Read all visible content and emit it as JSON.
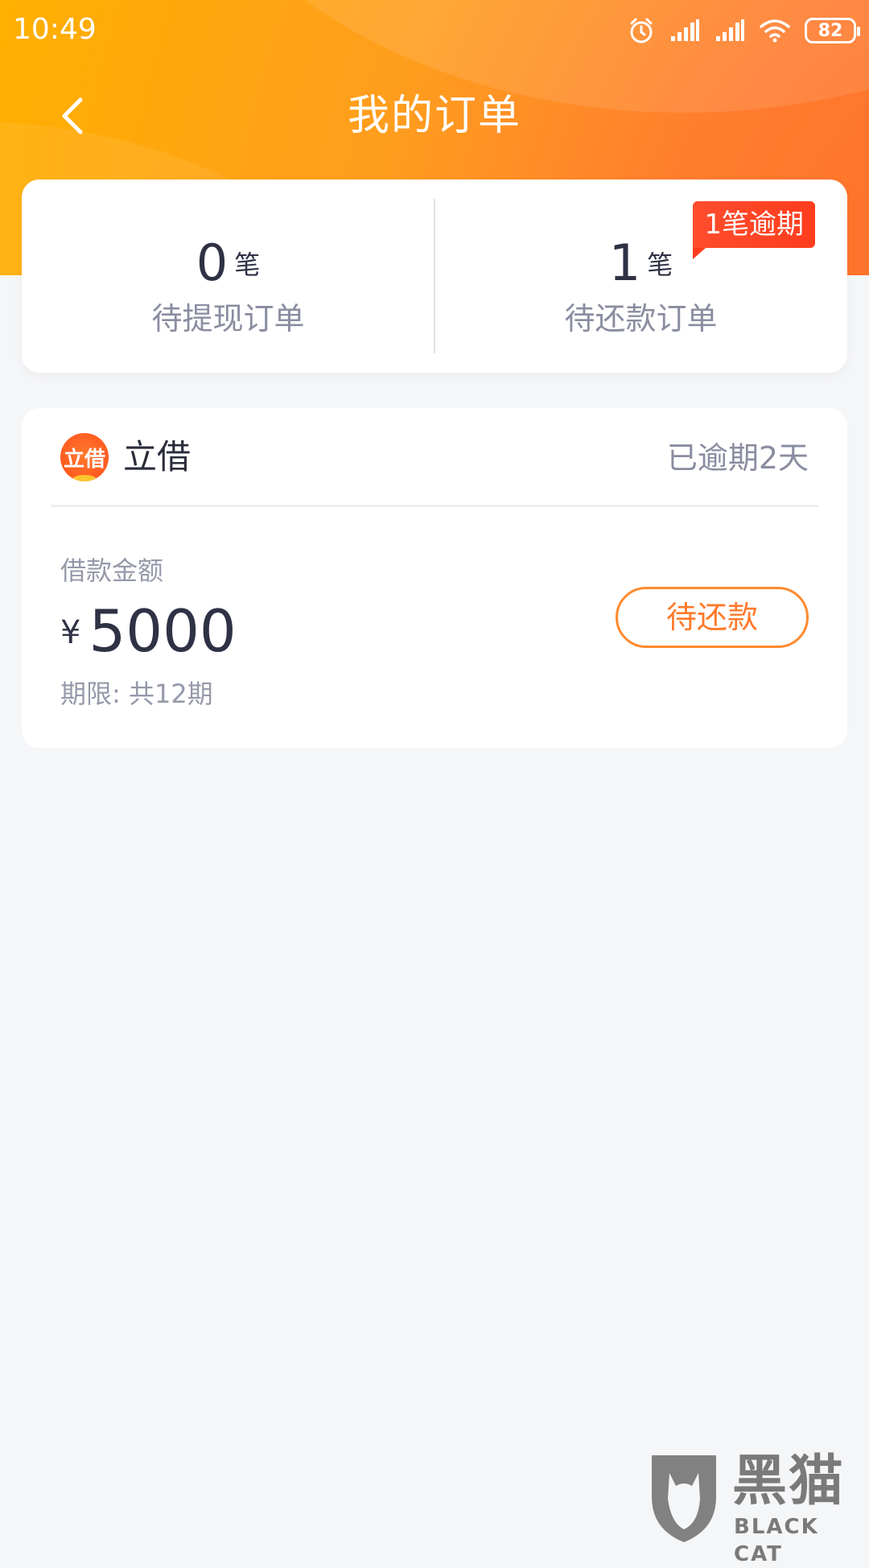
{
  "status_bar": {
    "time": "10:49",
    "battery": "82",
    "icons": [
      "alarm-icon",
      "signal-icon",
      "signal-icon",
      "wifi-icon",
      "battery-icon"
    ]
  },
  "nav": {
    "title": "我的订单",
    "back_icon": "chevron-left-icon"
  },
  "summary": {
    "pending_withdraw": {
      "count": "0",
      "unit": "笔",
      "label": "待提现订单"
    },
    "pending_repay": {
      "count": "1",
      "unit": "笔",
      "label": "待还款订单",
      "badge": "1笔逾期"
    }
  },
  "order": {
    "lender_name": "立借",
    "logo_text": "立借",
    "status": "已逾期2天",
    "amount_label": "借款金额",
    "currency": "¥",
    "amount": "5000",
    "term": "期限: 共12期",
    "action_label": "待还款"
  },
  "watermark": {
    "brand_cn": "黑猫",
    "brand_en": "BLACK CAT"
  },
  "colors": {
    "header_start": "#ffb000",
    "header_end": "#ff6a2a",
    "badge": "#ff3d1d",
    "accent": "#ff7a2a",
    "background": "#f5f6f8"
  }
}
